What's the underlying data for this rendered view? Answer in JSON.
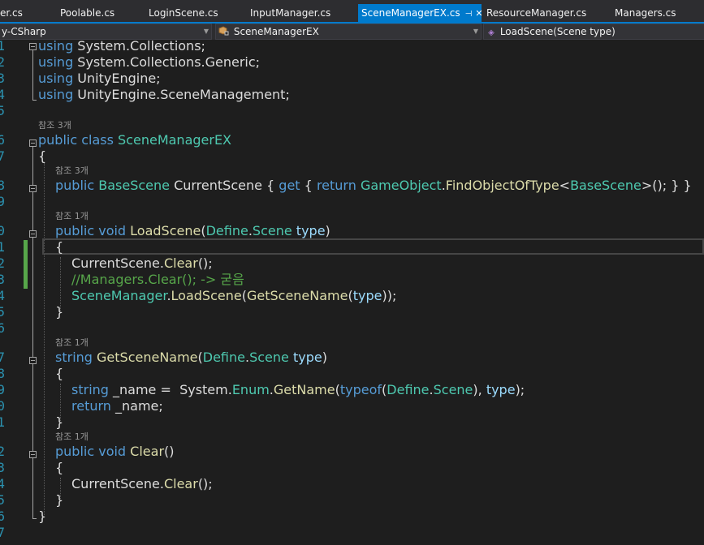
{
  "tabs": [
    {
      "label": "er.cs"
    },
    {
      "label": "Poolable.cs"
    },
    {
      "label": "LoginScene.cs"
    },
    {
      "label": "InputManager.cs"
    },
    {
      "label": "SceneManagerEX.cs",
      "pin": "⊣",
      "close": "✕"
    },
    {
      "label": "ResourceManager.cs"
    },
    {
      "label": "Managers.cs"
    }
  ],
  "nav": {
    "project": "y-CSharp",
    "type": "SceneManagerEX",
    "member": "LoadScene(Scene type)"
  },
  "line_numbers": [
    "1",
    "2",
    "3",
    "4",
    "5",
    "6",
    "7",
    "8",
    "9",
    "0",
    "1",
    "2",
    "3",
    "4",
    "5",
    "6",
    "7",
    "8",
    "9",
    "0",
    "1",
    "2",
    "3",
    "4",
    "5",
    "6",
    "7"
  ],
  "refs": {
    "class": "참조 3개",
    "current_scene": "참조 3개",
    "load_scene": "참조 1개",
    "get_scene_name": "참조 1개",
    "clear": "참조 1개"
  },
  "code": {
    "l1": {
      "kw": "using",
      "ns": " System.Collections;"
    },
    "l2": {
      "kw": "using",
      "ns": " System.Collections.Generic;"
    },
    "l3": {
      "kw": "using",
      "ns": " UnityEngine;"
    },
    "l4": {
      "kw": "using",
      "ns": " UnityEngine.SceneManagement;"
    },
    "l6": {
      "kw1": "public",
      "kw2": " class ",
      "ty": "SceneManagerEX"
    },
    "l7": {
      "t": "{"
    },
    "l8": {
      "kw": "public ",
      "ty": "BaseScene",
      "id": " CurrentScene { ",
      "get": "get",
      "b": " { ",
      "ret": "return ",
      "ty2": "GameObject",
      "dot": ".",
      "fn": "FindObjectOfType",
      "lt": "<",
      "ty3": "BaseScene",
      "end": ">(); } }"
    },
    "l10": {
      "kw": "public void ",
      "fn": "LoadScene",
      "p1": "(",
      "ty": "Define",
      "dot": ".",
      "ty2": "Scene",
      "sp": " ",
      "pm": "type",
      "p2": ")"
    },
    "l11": {
      "t": "{"
    },
    "l12": {
      "id": "CurrentScene.",
      "fn": "Clear",
      "end": "();"
    },
    "l13": {
      "cm": "//Managers.Clear(); -> 굳음"
    },
    "l14": {
      "ty": "SceneManager",
      "dot": ".",
      "fn": "LoadScene",
      "p1": "(",
      "fn2": "GetSceneName",
      "p2": "(",
      "pm": "type",
      "end": "));"
    },
    "l15": {
      "t": "}"
    },
    "l17": {
      "kw": "string ",
      "fn": "GetSceneName",
      "p1": "(",
      "ty": "Define",
      "dot": ".",
      "ty2": "Scene",
      "sp": " ",
      "pm": "type",
      "p2": ")"
    },
    "l18": {
      "t": "{"
    },
    "l19": {
      "kw": "string",
      "id": " _name =  System.",
      "ty": "Enum",
      "dot": ".",
      "fn": "GetName",
      "p1": "(",
      "kw2": "typeof",
      "p2": "(",
      "ty2": "Define",
      "dot2": ".",
      "ty3": "Scene",
      "p3": "), ",
      "pm": "type",
      "end": ");"
    },
    "l20": {
      "kw": "return",
      "id": " _name;"
    },
    "l21": {
      "t": "}"
    },
    "l22": {
      "kw": "public void ",
      "fn": "Clear",
      "end": "()"
    },
    "l23": {
      "t": "{"
    },
    "l24": {
      "id": "CurrentScene.",
      "fn": "Clear",
      "end": "();"
    },
    "l25": {
      "t": "}"
    },
    "l26": {
      "t": "}"
    }
  }
}
